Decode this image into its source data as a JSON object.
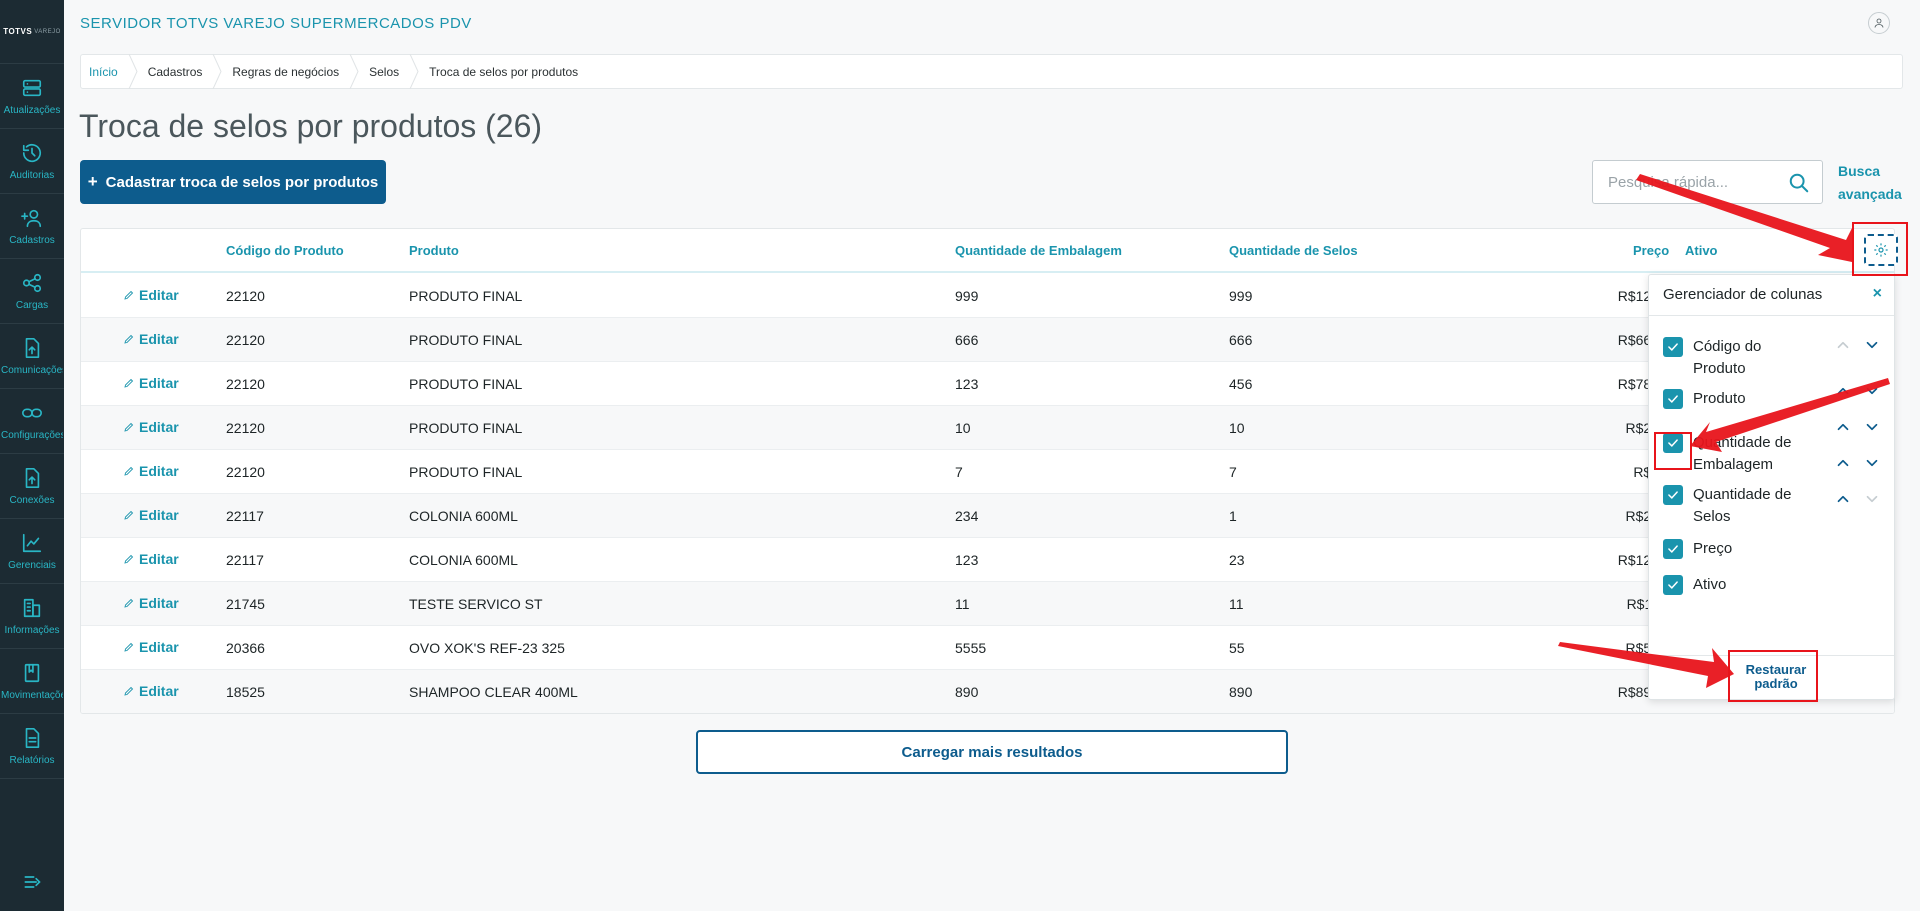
{
  "sidebar": {
    "logo": "TOTVS",
    "logo_sub": "VAREJO",
    "items": [
      {
        "label": "Atualizações",
        "icon": "server-icon"
      },
      {
        "label": "Auditorias",
        "icon": "history-icon"
      },
      {
        "label": "Cadastros",
        "icon": "add-user-icon"
      },
      {
        "label": "Cargas",
        "icon": "share-icon"
      },
      {
        "label": "Comunicações",
        "icon": "upload-file-icon"
      },
      {
        "label": "Configurações",
        "icon": "link-icon"
      },
      {
        "label": "Conexões",
        "icon": "upload-icon"
      },
      {
        "label": "Gerenciais",
        "icon": "chart-icon"
      },
      {
        "label": "Informações",
        "icon": "building-icon"
      },
      {
        "label": "Movimentações",
        "icon": "book-icon"
      },
      {
        "label": "Relatórios",
        "icon": "document-icon"
      }
    ]
  },
  "header": {
    "app_title": "SERVIDOR TOTVS VAREJO SUPERMERCADOS PDV"
  },
  "breadcrumb": [
    "Início",
    "Cadastros",
    "Regras de negócios",
    "Selos",
    "Troca de selos por produtos"
  ],
  "page": {
    "title": "Troca de selos por produtos (26)",
    "primary_button": "Cadastrar troca de selos por produtos",
    "search_placeholder": "Pesquisa rápida...",
    "advanced_search": "Busca avançada",
    "load_more": "Carregar mais resultados"
  },
  "table": {
    "columns": {
      "codigo": "Código do Produto",
      "produto": "Produto",
      "qtd_embalagem": "Quantidade de Embalagem",
      "qtd_selos": "Quantidade de Selos",
      "preco": "Preço",
      "ativo": "Ativo"
    },
    "edit_label": "Editar",
    "rows": [
      {
        "codigo": "22120",
        "produto": "PRODUTO FINAL",
        "qtd_embalagem": "999",
        "qtd_selos": "999",
        "preco": "R$123"
      },
      {
        "codigo": "22120",
        "produto": "PRODUTO FINAL",
        "qtd_embalagem": "666",
        "qtd_selos": "666",
        "preco": "R$666"
      },
      {
        "codigo": "22120",
        "produto": "PRODUTO FINAL",
        "qtd_embalagem": "123",
        "qtd_selos": "456",
        "preco": "R$789"
      },
      {
        "codigo": "22120",
        "produto": "PRODUTO FINAL",
        "qtd_embalagem": "10",
        "qtd_selos": "10",
        "preco": "R$20"
      },
      {
        "codigo": "22120",
        "produto": "PRODUTO FINAL",
        "qtd_embalagem": "7",
        "qtd_selos": "7",
        "preco": "R$7"
      },
      {
        "codigo": "22117",
        "produto": "COLONIA 600ML",
        "qtd_embalagem": "234",
        "qtd_selos": "1",
        "preco": "R$20"
      },
      {
        "codigo": "22117",
        "produto": "COLONIA 600ML",
        "qtd_embalagem": "123",
        "qtd_selos": "23",
        "preco": "R$123"
      },
      {
        "codigo": "21745",
        "produto": "TESTE SERVICO ST",
        "qtd_embalagem": "11",
        "qtd_selos": "11",
        "preco": "R$11"
      },
      {
        "codigo": "20366",
        "produto": "OVO XOK'S REF-23 325",
        "qtd_embalagem": "5555",
        "qtd_selos": "55",
        "preco": "R$55"
      },
      {
        "codigo": "18525",
        "produto": "SHAMPOO CLEAR 400ML",
        "qtd_embalagem": "890",
        "qtd_selos": "890",
        "preco": "R$890"
      }
    ]
  },
  "column_manager": {
    "title": "Gerenciador de colunas",
    "close_label": "×",
    "items": [
      {
        "label": "Código do Produto",
        "checked": true,
        "up_enabled": false,
        "down_enabled": true
      },
      {
        "label": "Produto",
        "checked": true,
        "up_enabled": true,
        "down_enabled": true
      },
      {
        "label": "Quantidade de Embalagem",
        "checked": true,
        "up_enabled": true,
        "down_enabled": true
      },
      {
        "label": "Quantidade de Selos",
        "checked": true,
        "up_enabled": true,
        "down_enabled": true
      },
      {
        "label": "Preço",
        "checked": true,
        "up_enabled": true,
        "down_enabled": false
      },
      {
        "label": "Ativo",
        "checked": true,
        "up_enabled": false,
        "down_enabled": false
      }
    ],
    "restore_label": "Restaurar padrão"
  },
  "colors": {
    "sidebar_bg": "#1c2b33",
    "accent": "#1a94ad",
    "primary": "#0d5c8d",
    "annotation_red": "#e8141b"
  }
}
